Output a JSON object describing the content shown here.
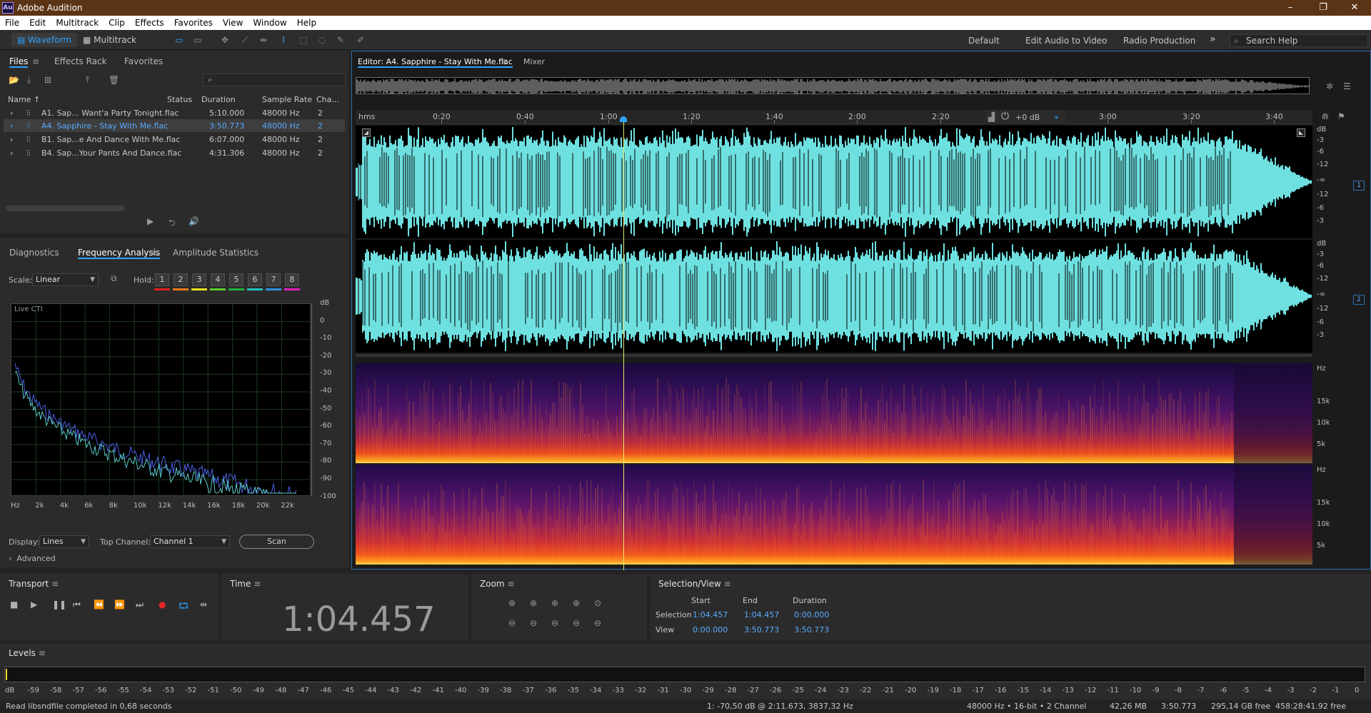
{
  "app": {
    "title": "Adobe Audition",
    "logo": "Au"
  },
  "window_controls": {
    "minimize": "–",
    "maximize": "❐",
    "close": "✕"
  },
  "menu": [
    "File",
    "Edit",
    "Multitrack",
    "Clip",
    "Effects",
    "Favorites",
    "View",
    "Window",
    "Help"
  ],
  "toolbar": {
    "waveform": "Waveform",
    "multitrack": "Multitrack",
    "workspaces": [
      "Default",
      "Edit Audio to Video",
      "Radio Production"
    ],
    "more": "»",
    "search_placeholder": "Search Help"
  },
  "files_panel": {
    "tabs": [
      "Files",
      "Effects Rack",
      "Favorites"
    ],
    "columns": [
      "Name ↑",
      "Status",
      "Duration",
      "Sample Rate",
      "Cha..."
    ],
    "rows": [
      {
        "name": "A1. Sap... Want'a Party Tonight.flac",
        "duration": "5:10.000",
        "rate": "48000 Hz",
        "ch": "2"
      },
      {
        "name": "A4. Sapphire - Stay With Me.flac",
        "duration": "3:50.773",
        "rate": "48000 Hz",
        "ch": "2"
      },
      {
        "name": "B1. Sap...e And Dance With Me.flac",
        "duration": "6:07.000",
        "rate": "48000 Hz",
        "ch": "2"
      },
      {
        "name": "B4. Sap...Your Pants And Dance.flac",
        "duration": "4:31.306",
        "rate": "48000 Hz",
        "ch": "2"
      }
    ]
  },
  "analysis_panel": {
    "tabs": [
      "Diagnostics",
      "Frequency Analysis",
      "Amplitude Statistics"
    ],
    "scale_label": "Scale:",
    "scale_value": "Linear",
    "hold_label": "Hold:",
    "hold": [
      "1",
      "2",
      "3",
      "4",
      "5",
      "6",
      "7",
      "8"
    ],
    "hold_colors": [
      "#e01e1e",
      "#f07a10",
      "#e8e020",
      "#5ad02a",
      "#20b040",
      "#20c0c0",
      "#3090e0",
      "#e020c0"
    ],
    "live_label": "Live CTI",
    "db_labels": [
      "dB",
      "0",
      "-10",
      "-20",
      "-30",
      "-40",
      "-50",
      "-60",
      "-70",
      "-80",
      "-90",
      "-100"
    ],
    "hz_labels": [
      "Hz",
      "2k",
      "4k",
      "6k",
      "8k",
      "10k",
      "12k",
      "14k",
      "16k",
      "18k",
      "20k",
      "22k"
    ],
    "display_label": "Display:",
    "display_value": "Lines",
    "top_channel_label": "Top Channel:",
    "top_channel_value": "Channel 1",
    "scan": "Scan",
    "advanced": "Advanced"
  },
  "editor": {
    "tab": "Editor: A4. Sapphire - Stay With Me.flac",
    "mixer": "Mixer",
    "ruler": [
      "hms",
      "0:20",
      "0:40",
      "1:00",
      "1:20",
      "1:40",
      "2:00",
      "2:20",
      "3:00",
      "3:20",
      "3:40"
    ],
    "gain": "+0 dB",
    "db_scale": [
      "dB",
      "-3",
      "-6",
      "-12",
      "-∞",
      "-12",
      "-6",
      "-3"
    ],
    "hz_scale": [
      "Hz",
      "15k",
      "10k",
      "5k"
    ],
    "channels": [
      "1",
      "2"
    ],
    "wave_color": "#6fe0e0"
  },
  "transport": {
    "title": "Transport"
  },
  "time": {
    "title": "Time",
    "value": "1:04.457"
  },
  "zoom": {
    "title": "Zoom"
  },
  "selection": {
    "title": "Selection/View",
    "headers": [
      "Start",
      "End",
      "Duration"
    ],
    "selection_label": "Selection",
    "selection": [
      "1:04.457",
      "1:04.457",
      "0:00.000"
    ],
    "view_label": "View",
    "view": [
      "0:00.000",
      "3:50.773",
      "3:50.773"
    ]
  },
  "levels": {
    "title": "Levels",
    "scale": [
      "dB",
      "-59",
      "-58",
      "-57",
      "-56",
      "-55",
      "-54",
      "-53",
      "-52",
      "-51",
      "-50",
      "-49",
      "-48",
      "-47",
      "-46",
      "-45",
      "-44",
      "-43",
      "-42",
      "-41",
      "-40",
      "-39",
      "-38",
      "-37",
      "-36",
      "-35",
      "-34",
      "-33",
      "-32",
      "-31",
      "-30",
      "-29",
      "-28",
      "-27",
      "-26",
      "-25",
      "-24",
      "-23",
      "-22",
      "-21",
      "-20",
      "-19",
      "-18",
      "-17",
      "-16",
      "-15",
      "-14",
      "-13",
      "-12",
      "-11",
      "-10",
      "-9",
      "-8",
      "-7",
      "-6",
      "-5",
      "-4",
      "-3",
      "-2",
      "-1",
      "0"
    ]
  },
  "status": {
    "message": "Read libsndfile completed in 0,68 seconds",
    "cursor": "1: -70,50 dB @ 2:11.673, 3837,32 Hz",
    "format": "48000 Hz • 16-bit • 2 Channel",
    "size": "42,26 MB",
    "duration": "3:50.773",
    "free": "295,14 GB free",
    "free_time": "458:28:41.92 free"
  }
}
